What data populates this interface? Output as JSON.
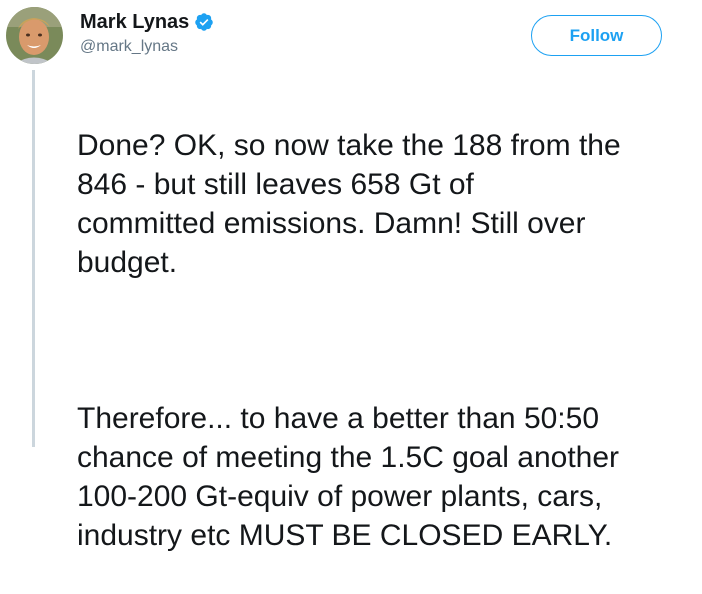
{
  "author": {
    "display_name": "Mark Lynas",
    "handle": "@mark_lynas",
    "verified": true,
    "avatar_icon": "profile-photo"
  },
  "actions": {
    "follow_label": "Follow"
  },
  "tweet": {
    "paragraph_1": "Done? OK, so now take the 188 from the\n846 - but still leaves 658 Gt of\ncommitted emissions. Damn! Still over\nbudget.",
    "paragraph_2": "Therefore... to have a better than 50:50\nchance of meeting the 1.5C goal another\n100-200 Gt-equiv of power plants, cars,\nindustry etc MUST BE CLOSED EARLY."
  },
  "colors": {
    "accent": "#1da1f2",
    "text": "#14171a",
    "secondary_text": "#657786",
    "thread_line": "#ccd6dd"
  }
}
